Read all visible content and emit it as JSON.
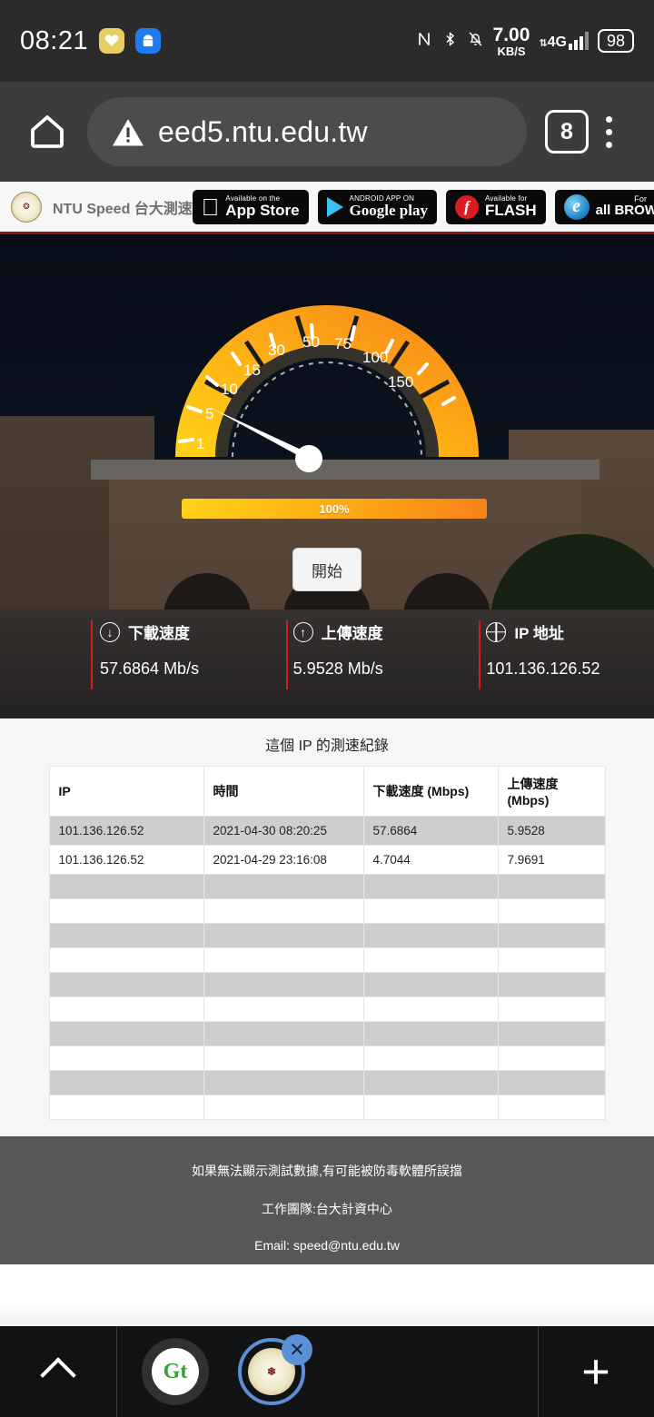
{
  "status_bar": {
    "clock": "08:21",
    "apps": [
      "heart-app-icon",
      "android-app-icon"
    ],
    "icons": [
      "nfc-icon",
      "bluetooth-icon",
      "notification-muted-icon"
    ],
    "net_speed_value": "7.00",
    "net_speed_unit": "KB/S",
    "network_type": "4G",
    "battery": "98"
  },
  "browser": {
    "home_icon": "home-icon",
    "security_icon": "warning-triangle-icon",
    "url": "eed5.ntu.edu.tw",
    "tab_count": "8",
    "menu_icon": "overflow-menu-icon"
  },
  "page_header": {
    "logo": "ntu-crest-logo",
    "brand": "NTU Speed 台大測速",
    "badges": [
      {
        "name": "app-store-badge",
        "icon": "apple-logo",
        "sub": "Available on the",
        "main": "App Store"
      },
      {
        "name": "google-play-badge",
        "icon": "play-triangle",
        "sub": "ANDROID APP ON",
        "main": "Google play"
      },
      {
        "name": "flash-badge",
        "icon": "flash-logo",
        "sub": "Available for",
        "main": "FLASH"
      },
      {
        "name": "browser-badge",
        "icon": "ie-logo",
        "sub": "For",
        "main": "all BROWSER"
      }
    ]
  },
  "gauge": {
    "ticks": [
      "1",
      "5",
      "10",
      "15",
      "30",
      "50",
      "75",
      "100",
      "150"
    ],
    "needle_value": "5.5",
    "colors": {
      "start": "#ffd21a",
      "mid": "#ffae12",
      "end": "#f7821b"
    }
  },
  "progress": {
    "label": "100%",
    "percent": 100
  },
  "start_button": {
    "label": "開始"
  },
  "stats": [
    {
      "name": "download-speed",
      "icon": "arrow-down-icon",
      "label": "下載速度",
      "value": "57.6864 Mb/s"
    },
    {
      "name": "upload-speed",
      "icon": "arrow-up-icon",
      "label": "上傳速度",
      "value": "5.9528 Mb/s"
    },
    {
      "name": "ip-address",
      "icon": "globe-icon",
      "label": "IP 地址",
      "value": "101.136.126.52"
    }
  ],
  "records": {
    "title": "這個 IP 的測速紀錄",
    "columns": [
      "IP",
      "時間",
      "下載速度 (Mbps)",
      "上傳速度 (Mbps)"
    ],
    "rows": [
      [
        "101.136.126.52",
        "2021-04-30 08:20:25",
        "57.6864",
        "5.9528"
      ],
      [
        "101.136.126.52",
        "2021-04-29 23:16:08",
        "4.7044",
        "7.9691"
      ],
      [
        "",
        "",
        "",
        ""
      ],
      [
        "",
        "",
        "",
        ""
      ],
      [
        "",
        "",
        "",
        ""
      ],
      [
        "",
        "",
        "",
        ""
      ],
      [
        "",
        "",
        "",
        ""
      ],
      [
        "",
        "",
        "",
        ""
      ],
      [
        "",
        "",
        "",
        ""
      ],
      [
        "",
        "",
        "",
        ""
      ],
      [
        "",
        "",
        "",
        ""
      ],
      [
        "",
        "",
        "",
        ""
      ]
    ]
  },
  "footer": {
    "line1": "如果無法顯示測試數據,有可能被防毒軟體所誤擋",
    "line2": "工作團隊:台大計資中心",
    "line3": "Email: speed@ntu.edu.tw"
  },
  "dock": {
    "up_icon": "chevron-up-icon",
    "tabs": [
      {
        "name": "dock-tab-gt",
        "label": "Gt"
      },
      {
        "name": "dock-tab-ntu",
        "label": "NTU"
      }
    ],
    "close_label": "✕",
    "plus_label": "+"
  }
}
